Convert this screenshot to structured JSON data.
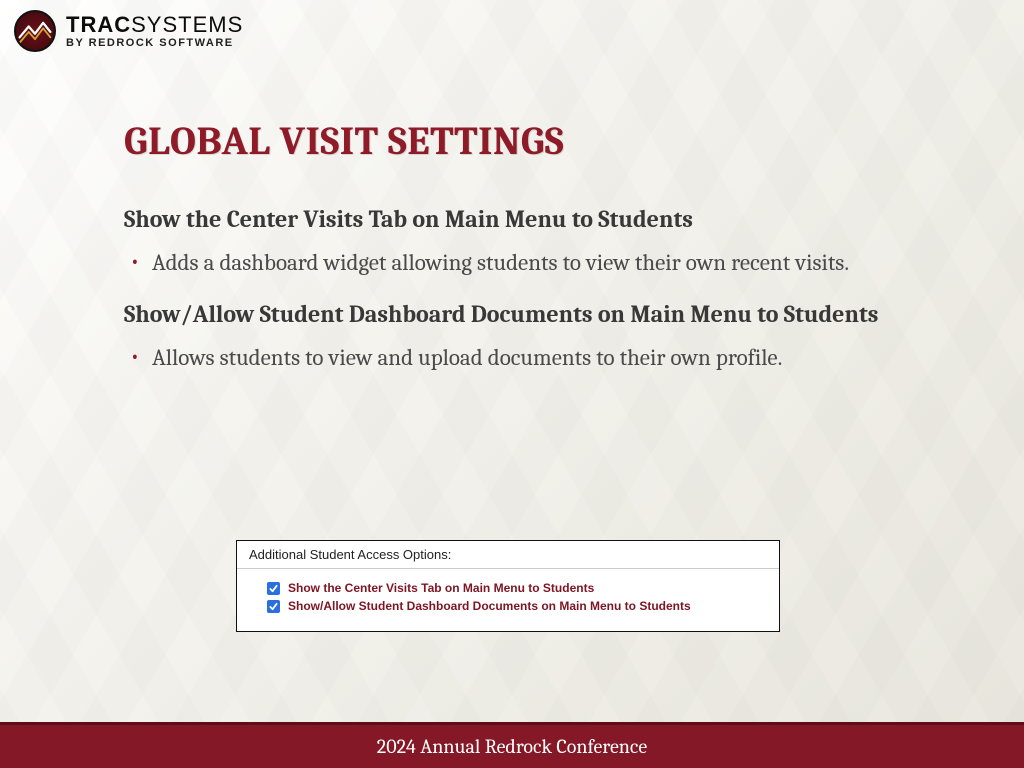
{
  "brand": {
    "main_a": "TRAC",
    "main_b": "SYSTEMS",
    "sub": "BY REDROCK SOFTWARE"
  },
  "title": "GLOBAL VISIT SETTINGS",
  "sections": [
    {
      "heading": "Show the Center Visits Tab on Main Menu to Students",
      "bullet": "Adds a dashboard widget allowing students to view their own recent visits."
    },
    {
      "heading": "Show/Allow Student Dashboard Documents on Main Menu to Students",
      "bullet": " Allows students to view and upload documents to their own profile."
    }
  ],
  "panel": {
    "header": "Additional Student Access Options:",
    "options": [
      {
        "checked": true,
        "label": "Show the Center Visits Tab on Main Menu to Students"
      },
      {
        "checked": true,
        "label": "Show/Allow Student Dashboard Documents on Main Menu to Students"
      }
    ]
  },
  "footer": "2024 Annual Redrock Conference"
}
